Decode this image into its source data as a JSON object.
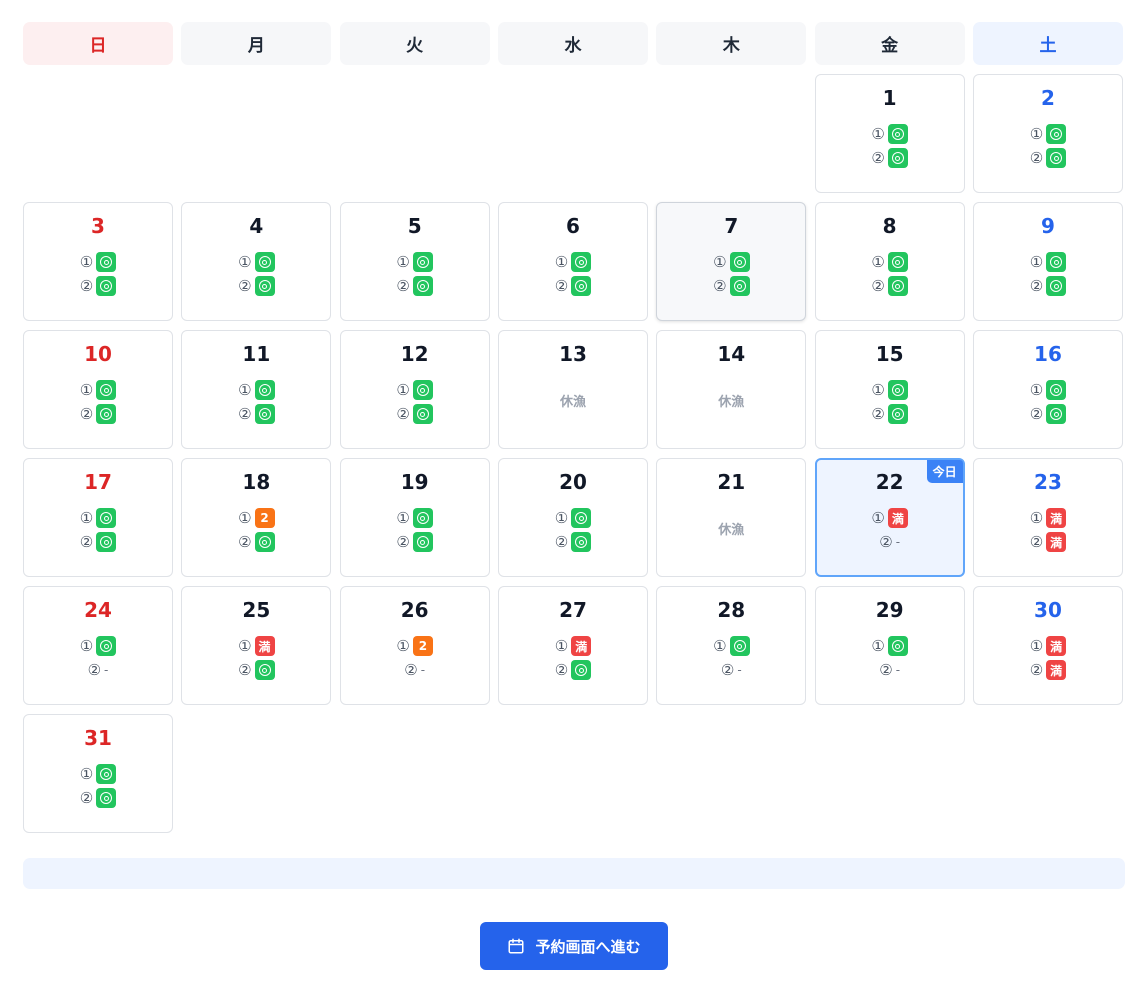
{
  "weekdays": [
    "日",
    "月",
    "火",
    "水",
    "木",
    "金",
    "土"
  ],
  "labels": {
    "slot1": "①",
    "slot2": "②",
    "available_mark": "◎",
    "full_mark": "満",
    "closed": "休漁",
    "none": "-",
    "today": "今日"
  },
  "colors": {
    "available": "#22c55e",
    "full": "#ef4444",
    "few": "#f97316",
    "sunday": "#dc2626",
    "saturday": "#2563eb",
    "primary": "#2563eb"
  },
  "leading_blank_days": 5,
  "days": [
    {
      "date": "1",
      "s1": "ok",
      "s2": "ok"
    },
    {
      "date": "2",
      "s1": "ok",
      "s2": "ok"
    },
    {
      "date": "3",
      "s1": "ok",
      "s2": "ok"
    },
    {
      "date": "4",
      "s1": "ok",
      "s2": "ok"
    },
    {
      "date": "5",
      "s1": "ok",
      "s2": "ok"
    },
    {
      "date": "6",
      "s1": "ok",
      "s2": "ok"
    },
    {
      "date": "7",
      "s1": "ok",
      "s2": "ok",
      "hover": true
    },
    {
      "date": "8",
      "s1": "ok",
      "s2": "ok"
    },
    {
      "date": "9",
      "s1": "ok",
      "s2": "ok"
    },
    {
      "date": "10",
      "s1": "ok",
      "s2": "ok"
    },
    {
      "date": "11",
      "s1": "ok",
      "s2": "ok"
    },
    {
      "date": "12",
      "s1": "ok",
      "s2": "ok"
    },
    {
      "date": "13",
      "closed": true
    },
    {
      "date": "14",
      "closed": true
    },
    {
      "date": "15",
      "s1": "ok",
      "s2": "ok"
    },
    {
      "date": "16",
      "s1": "ok",
      "s2": "ok"
    },
    {
      "date": "17",
      "s1": "ok",
      "s2": "ok"
    },
    {
      "date": "18",
      "s1": "2",
      "s2": "ok"
    },
    {
      "date": "19",
      "s1": "ok",
      "s2": "ok"
    },
    {
      "date": "20",
      "s1": "ok",
      "s2": "ok"
    },
    {
      "date": "21",
      "closed": true
    },
    {
      "date": "22",
      "s1": "full",
      "s2": "-",
      "today": true
    },
    {
      "date": "23",
      "s1": "full",
      "s2": "full"
    },
    {
      "date": "24",
      "s1": "ok",
      "s2": "-"
    },
    {
      "date": "25",
      "s1": "full",
      "s2": "ok"
    },
    {
      "date": "26",
      "s1": "2",
      "s2": "-"
    },
    {
      "date": "27",
      "s1": "full",
      "s2": "ok"
    },
    {
      "date": "28",
      "s1": "ok",
      "s2": "-"
    },
    {
      "date": "29",
      "s1": "ok",
      "s2": "-"
    },
    {
      "date": "30",
      "s1": "full",
      "s2": "full"
    },
    {
      "date": "31",
      "s1": "ok",
      "s2": "ok"
    }
  ],
  "info_bar": "",
  "cta": {
    "label": "予約画面へ進む",
    "icon": "calendar-icon"
  }
}
